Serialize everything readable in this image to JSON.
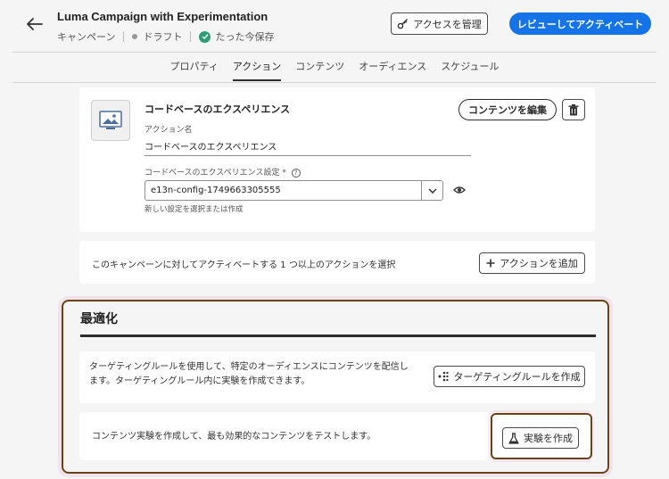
{
  "header": {
    "title": "Luma Campaign with Experimentation",
    "breadcrumb_type": "キャンペーン",
    "status": "ドラフト",
    "saved": "たった今保存",
    "access_button": "アクセスを管理",
    "review_button": "レビューしてアクティベート"
  },
  "tabs": [
    {
      "label": "プロパティ"
    },
    {
      "label": "アクション"
    },
    {
      "label": "コンテンツ"
    },
    {
      "label": "オーディエンス"
    },
    {
      "label": "スケジュール"
    }
  ],
  "active_tab": "アクション",
  "experience_card": {
    "title": "コードベースのエクスペリエンス",
    "action_name_label": "アクション名",
    "action_name_value": "コードベースのエクスペリエンス",
    "config_label": "コードベースのエクスペリエンス設定",
    "required_mark": "*",
    "config_value": "e13n-config-1749663305555",
    "help_text": "新しい設定を選択または作成",
    "edit_button": "コンテンツを編集"
  },
  "add_action": {
    "text": "このキャンペーンに対してアクティベートする 1 つ以上のアクションを選択",
    "button": "アクションを追加"
  },
  "optimization": {
    "title": "最適化",
    "targeting_text": "ターゲティングルールを使用して、特定のオーディエンスにコンテンツを配信します。ターゲティングルール内に実験を作成できます。",
    "targeting_button": "ターゲティングルールを作成",
    "experiment_text": "コンテンツ実験を作成して、最も効果的なコンテンツをテストします。",
    "experiment_button": "実験を作成"
  },
  "colors": {
    "accent": "#1473e6",
    "highlight_border": "#6b4218",
    "success": "#2d9d78"
  },
  "icons": [
    "back-arrow-icon",
    "key-icon",
    "check-circle-icon",
    "image-icon",
    "trash-icon",
    "chevron-down-icon",
    "eye-icon",
    "info-icon",
    "plus-icon",
    "targeting-icon",
    "flask-icon"
  ]
}
